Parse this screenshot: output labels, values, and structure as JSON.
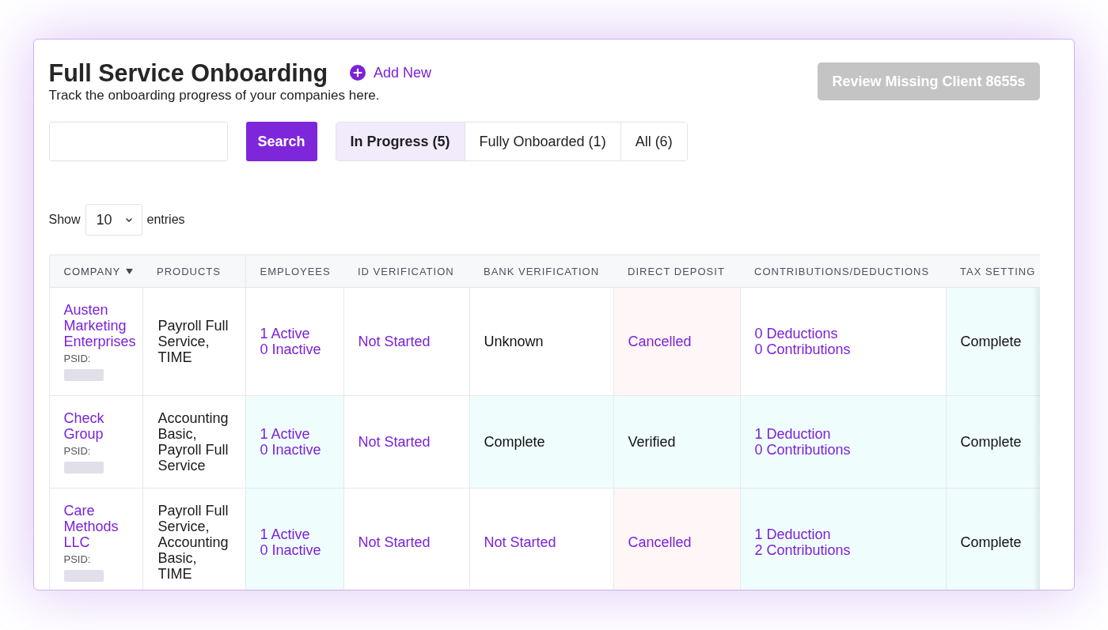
{
  "header": {
    "title": "Full Service Onboarding",
    "add_button": "Add New",
    "subtitle": "Track the onboarding progress of your companies here.",
    "review_button": {
      "label": "Review Missing Client 8655s",
      "disabled": true
    }
  },
  "search": {
    "button": "Search"
  },
  "filter_tabs": [
    {
      "label": "In Progress (5)",
      "selected": true
    },
    {
      "label": "Fully Onboarded (1)",
      "selected": false
    },
    {
      "label": "All (6)",
      "selected": false
    }
  ],
  "entries": {
    "prefix": "Show",
    "value": "10",
    "suffix": "entries"
  },
  "table": {
    "columns": [
      {
        "label": "COMPANY",
        "sorted": true
      },
      {
        "label": "PRODUCTS",
        "sorted": false
      },
      {
        "label": "EMPLOYEES",
        "sorted": false
      },
      {
        "label": "ID VERIFICATION",
        "sorted": false
      },
      {
        "label": "BANK VERIFICATION",
        "sorted": false
      },
      {
        "label": "DIRECT DEPOSIT",
        "sorted": false
      },
      {
        "label": "CONTRIBUTIONS/DEDUCTIONS",
        "sorted": false
      },
      {
        "label": "TAX SETTING",
        "sorted": false
      }
    ],
    "rows": [
      {
        "cells": [
          {
            "kind": "company",
            "name": "Austen Marketing Enterprises",
            "psid_label": "PSID:",
            "psid_redacted": true
          },
          {
            "kind": "text",
            "text": "Payroll Full Service, TIME"
          },
          {
            "kind": "status",
            "lines": [
              "1 Active",
              "0 Inactive"
            ],
            "link": true,
            "color": "#ffffff"
          },
          {
            "kind": "status",
            "lines": [
              "Not Started"
            ],
            "link": true,
            "color": "#ffffff"
          },
          {
            "kind": "status",
            "lines": [
              "Unknown"
            ],
            "link": false,
            "color": "#ffffff"
          },
          {
            "kind": "status",
            "lines": [
              "Cancelled"
            ],
            "link": true,
            "color": "#fff7f7"
          },
          {
            "kind": "status",
            "lines": [
              "0 Deductions",
              "0 Contributions"
            ],
            "link": true,
            "color": "#ffffff"
          },
          {
            "kind": "status",
            "lines": [
              "Complete"
            ],
            "link": false,
            "color": "#f0fdfd"
          }
        ]
      },
      {
        "cells": [
          {
            "kind": "company",
            "name": "Check Group",
            "psid_label": "PSID:",
            "psid_redacted": true
          },
          {
            "kind": "text",
            "text": "Accounting Basic, Payroll Full Service"
          },
          {
            "kind": "status",
            "lines": [
              "1 Active",
              "0 Inactive"
            ],
            "link": true,
            "color": "#f0fdfd"
          },
          {
            "kind": "status",
            "lines": [
              "Not Started"
            ],
            "link": true,
            "color": "#ffffff"
          },
          {
            "kind": "status",
            "lines": [
              "Complete"
            ],
            "link": false,
            "color": "#f0fdfd"
          },
          {
            "kind": "status",
            "lines": [
              "Verified"
            ],
            "link": false,
            "color": "#f0fdfd"
          },
          {
            "kind": "status",
            "lines": [
              "1 Deduction",
              "0 Contributions"
            ],
            "link": true,
            "color": "#f0fdfd"
          },
          {
            "kind": "status",
            "lines": [
              "Complete"
            ],
            "link": false,
            "color": "#f0fdfd"
          }
        ]
      },
      {
        "cells": [
          {
            "kind": "company",
            "name": "Care Methods LLC",
            "psid_label": "PSID:",
            "psid_redacted": true
          },
          {
            "kind": "text",
            "text": "Payroll Full Service, Accounting Basic, TIME"
          },
          {
            "kind": "status",
            "lines": [
              "1 Active",
              "0 Inactive"
            ],
            "link": true,
            "color": "#f0fdfd"
          },
          {
            "kind": "status",
            "lines": [
              "Not Started"
            ],
            "link": true,
            "color": "#ffffff"
          },
          {
            "kind": "status",
            "lines": [
              "Not Started"
            ],
            "link": true,
            "color": "#ffffff"
          },
          {
            "kind": "status",
            "lines": [
              "Cancelled"
            ],
            "link": true,
            "color": "#fff7f7"
          },
          {
            "kind": "status",
            "lines": [
              "1 Deduction",
              "2 Contributions"
            ],
            "link": true,
            "color": "#f0fdfd"
          },
          {
            "kind": "status",
            "lines": [
              "Complete"
            ],
            "link": false,
            "color": "#f0fdfd"
          }
        ]
      }
    ]
  }
}
